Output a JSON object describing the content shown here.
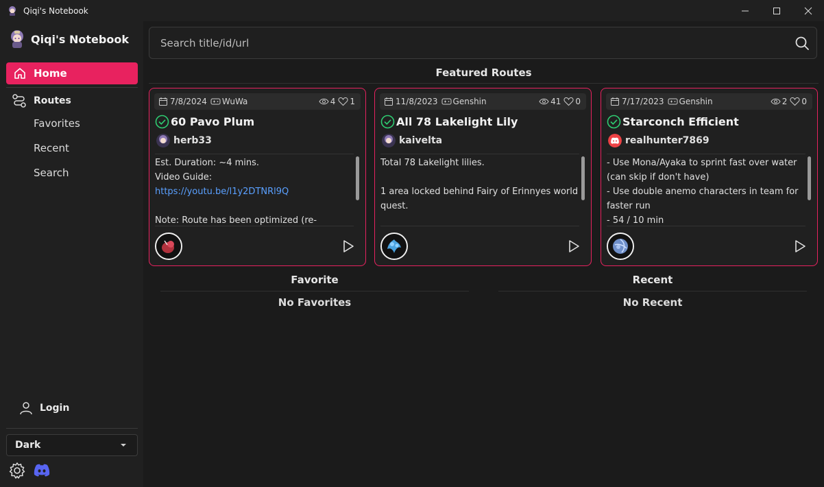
{
  "window": {
    "title": "Qiqi's Notebook"
  },
  "sidebar": {
    "brand": "Qiqi's Notebook",
    "home": "Home",
    "routes": "Routes",
    "sub": [
      "Favorites",
      "Recent",
      "Search"
    ],
    "login": "Login",
    "theme": "Dark"
  },
  "search": {
    "placeholder": "Search title/id/url"
  },
  "featured": {
    "title": "Featured Routes",
    "cards": [
      {
        "date": "7/8/2024",
        "game": "WuWa",
        "views": "4",
        "likes": "1",
        "title": "60 Pavo Plum",
        "author": "herb33",
        "body_lines": [
          "Est. Duration: ~4 mins.",
          "Video Guide:"
        ],
        "link": "https://youtu.be/l1y2DTNRl9Q",
        "body_after": "Note: Route has been optimized (re-"
      },
      {
        "date": "11/8/2023",
        "game": "Genshin",
        "views": "41",
        "likes": "0",
        "title": "All 78 Lakelight Lily",
        "author": "kaivelta",
        "body": "Total 78 Lakelight lilies.\n\n1 area locked behind Fairy of Erinnyes world quest."
      },
      {
        "date": "7/17/2023",
        "game": "Genshin",
        "views": "2",
        "likes": "0",
        "title": "Starconch Efficient",
        "author": "realhunter7869",
        "body": "- Use Mona/Ayaka to sprint fast over water (can skip if don't have)\n- Use double anemo characters in team for faster run\n- 54 / 10 min"
      }
    ]
  },
  "favorite": {
    "title": "Favorite",
    "empty": "No Favorites"
  },
  "recent": {
    "title": "Recent",
    "empty": "No Recent"
  },
  "colors": {
    "accent": "#e8225f",
    "verified": "#2ecc71",
    "link": "#5aa0ff",
    "discord": "#5865f2"
  },
  "icons": [
    "home-icon",
    "routes-icon",
    "user-icon",
    "gear-icon",
    "discord-icon",
    "search-icon",
    "calendar-icon",
    "gamepad-icon",
    "eye-icon",
    "heart-icon",
    "check-circle-icon",
    "play-icon"
  ]
}
